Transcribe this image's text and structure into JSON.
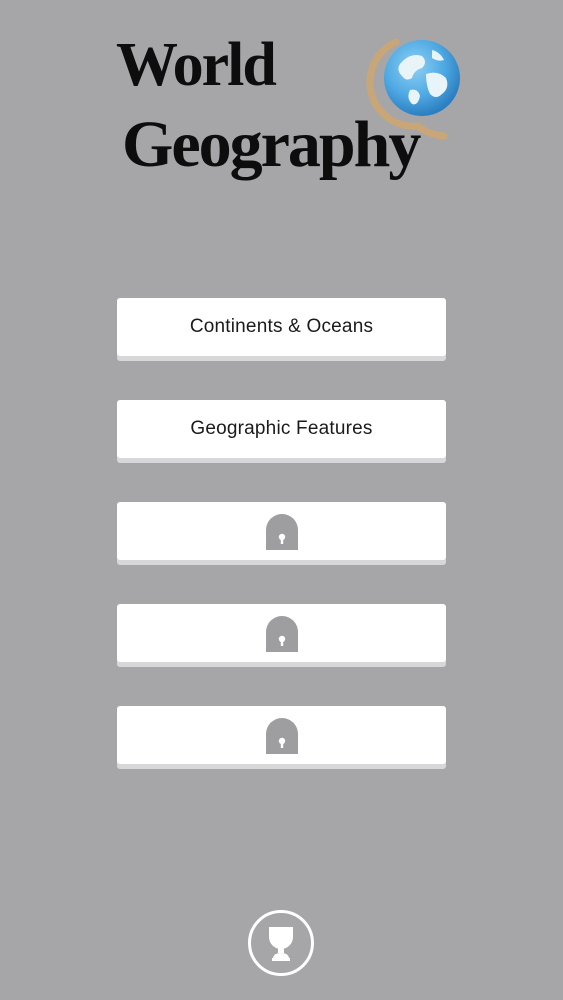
{
  "app": {
    "title_line1": "World",
    "title_line2": "Geography"
  },
  "menu": {
    "items": [
      {
        "label": "Continents & Oceans",
        "locked": false
      },
      {
        "label": "Geographic Features",
        "locked": false
      },
      {
        "label": "",
        "locked": true
      },
      {
        "label": "",
        "locked": true
      },
      {
        "label": "",
        "locked": true
      }
    ]
  },
  "icons": {
    "lock": "lock-icon",
    "trophy": "trophy-icon",
    "globe": "globe-icon"
  },
  "colors": {
    "background": "#a6a5a8",
    "button": "#ffffff",
    "lock": "#9e9d9f",
    "globe_ocean": "#4fa9e3",
    "globe_stand": "#c8a678"
  }
}
